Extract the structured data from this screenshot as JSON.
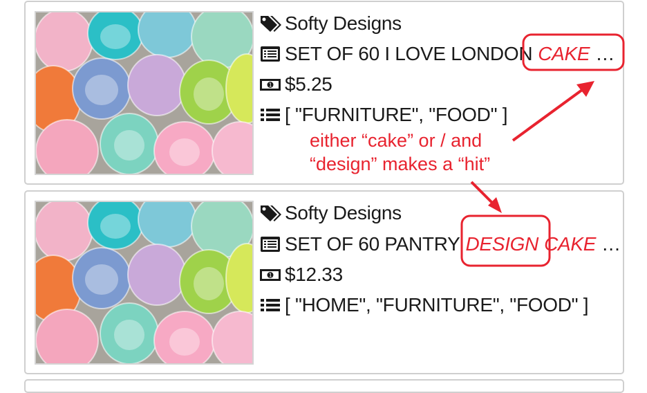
{
  "results": [
    {
      "brand": "Softy Designs",
      "title_plain": "SET OF 60 I LOVE LONDON",
      "title_match_1": "CAKE",
      "title_match_2": "",
      "title_ellipsis": "…",
      "price": "$5.25",
      "categories": "[ \"FURNITURE\", \"FOOD\" ]",
      "image_alt": "cupcake cases"
    },
    {
      "brand": "Softy Designs",
      "title_plain": "SET OF 60 PANTRY",
      "title_match_1": "DESIGN",
      "title_match_2": "CAKE",
      "title_ellipsis": "…",
      "price": "$12.33",
      "categories": "[ \"HOME\", \"FURNITURE\", \"FOOD\" ]",
      "image_alt": "cupcake cases"
    }
  ],
  "annotation": {
    "line1": "either “cake” or / and",
    "line2": "“design” makes a “hit”",
    "color": "#e8232f"
  },
  "icons": {
    "brand": "tags-icon",
    "title": "list-alt-icon",
    "price": "money-icon",
    "categories": "list-icon"
  },
  "colors": {
    "highlight": "#e8232f",
    "card_border": "#cfcfcf",
    "text": "#1a1a1a"
  }
}
